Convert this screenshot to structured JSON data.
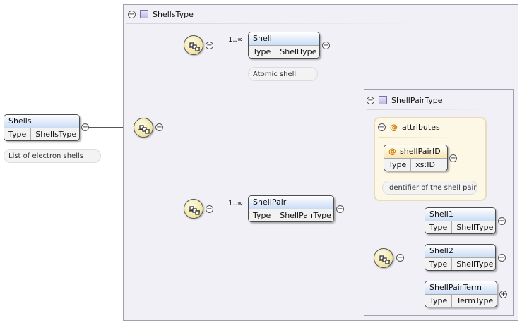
{
  "colors": {
    "wire": "#555555",
    "wire_light": "#c8c8c8",
    "frame": "#a0a0ab",
    "frame_fill": "#f0f0f6"
  },
  "root": {
    "name": "Shells",
    "type_key": "Type",
    "type_value": "ShellsType",
    "doc": "List of electron shells"
  },
  "shells_type": {
    "title": "ShellsType"
  },
  "shell": {
    "name": "Shell",
    "type_key": "Type",
    "type_value": "ShellType",
    "cardinality": "1..∞",
    "doc": "Atomic shell"
  },
  "shell_pair": {
    "name": "ShellPair",
    "type_key": "Type",
    "type_value": "ShellPairType",
    "cardinality": "1..∞"
  },
  "shell_pair_type": {
    "title": "ShellPairType",
    "attributes_label": "attributes",
    "attribute": {
      "name": "shellPairID",
      "type_key": "Type",
      "type_value": "xs:ID",
      "doc": "Identifier of the shell pair"
    },
    "children": [
      {
        "name": "Shell1",
        "type_key": "Type",
        "type_value": "ShellType"
      },
      {
        "name": "Shell2",
        "type_key": "Type",
        "type_value": "ShellType"
      },
      {
        "name": "ShellPairTerm",
        "type_key": "Type",
        "type_value": "TermType"
      }
    ]
  },
  "toggles": {
    "collapse": "−",
    "expand": "+"
  },
  "icons": {
    "attribute": "@",
    "sequence": "sequence-icon",
    "type": "complex-type-icon"
  }
}
